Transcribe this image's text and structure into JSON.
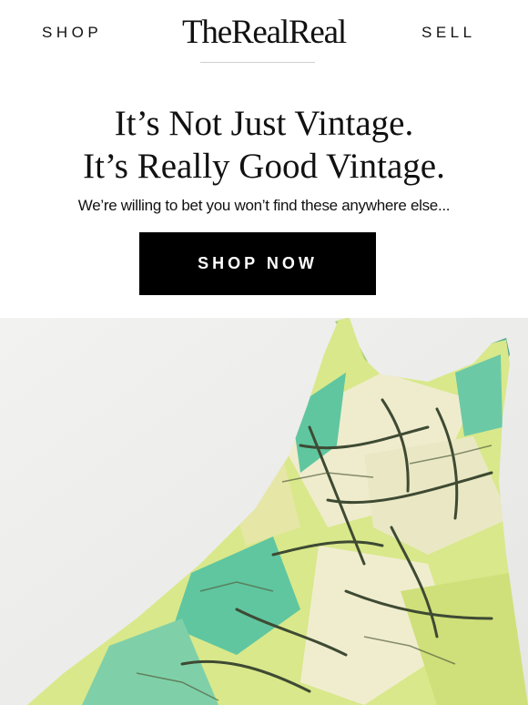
{
  "header": {
    "shop_label": "SHOP",
    "logo_text": "TheRealReal",
    "sell_label": "SELL"
  },
  "hero": {
    "headline_line1": "It’s Not Just Vintage.",
    "headline_line2": "It’s Really Good Vintage.",
    "subhead": "We’re willing to bet you won’t find these anywhere else...",
    "cta_label": "SHOP NOW"
  },
  "product_image": {
    "subject": "green-and-cream-print-slip-dress",
    "colors": {
      "background": "#ededec",
      "mint": "#5fc6a0",
      "lime": "#d9e88a",
      "cream": "#efeccd",
      "line": "#3e4a33"
    }
  }
}
